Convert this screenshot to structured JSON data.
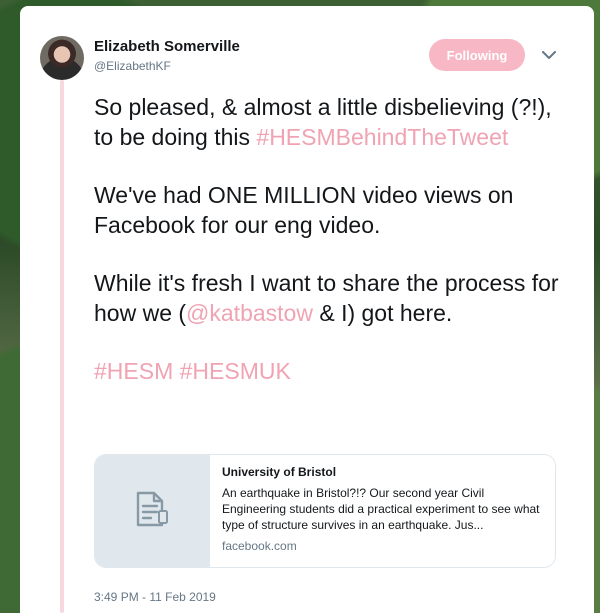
{
  "author": {
    "name": "Elizabeth Somerville",
    "handle": "@ElizabethKF"
  },
  "follow_button": {
    "label": "Following"
  },
  "menu": {
    "icon": "chevron-down-icon"
  },
  "tweet": {
    "para1_text": "So pleased, & almost a little disbelieving (?!), to be doing this",
    "para1_hashtag": "#HESMBehindTheTweet",
    "para2_text": "We've had ONE MILLION video views on Facebook for our eng video.",
    "para3_before": "While it's fresh I want to share the process for how we (",
    "para3_mention": "@katbastow",
    "para3_after": " & I) got here.",
    "hashtag1": "#HESM",
    "hashtag2": "#HESMUK"
  },
  "link_card": {
    "icon": "document-icon",
    "title": "University of Bristol",
    "description": "An earthquake in Bristol?!? Our second year Civil Engineering students did a practical experiment to see what type of structure survives in an earthquake. Jus...",
    "domain": "facebook.com"
  },
  "timestamp": "3:49 PM - 11 Feb 2019",
  "colors": {
    "accent": "#f7b7c4",
    "link": "#f0a3b2",
    "thread_line": "#f6d8de",
    "text": "#14171a",
    "muted": "#657786"
  }
}
